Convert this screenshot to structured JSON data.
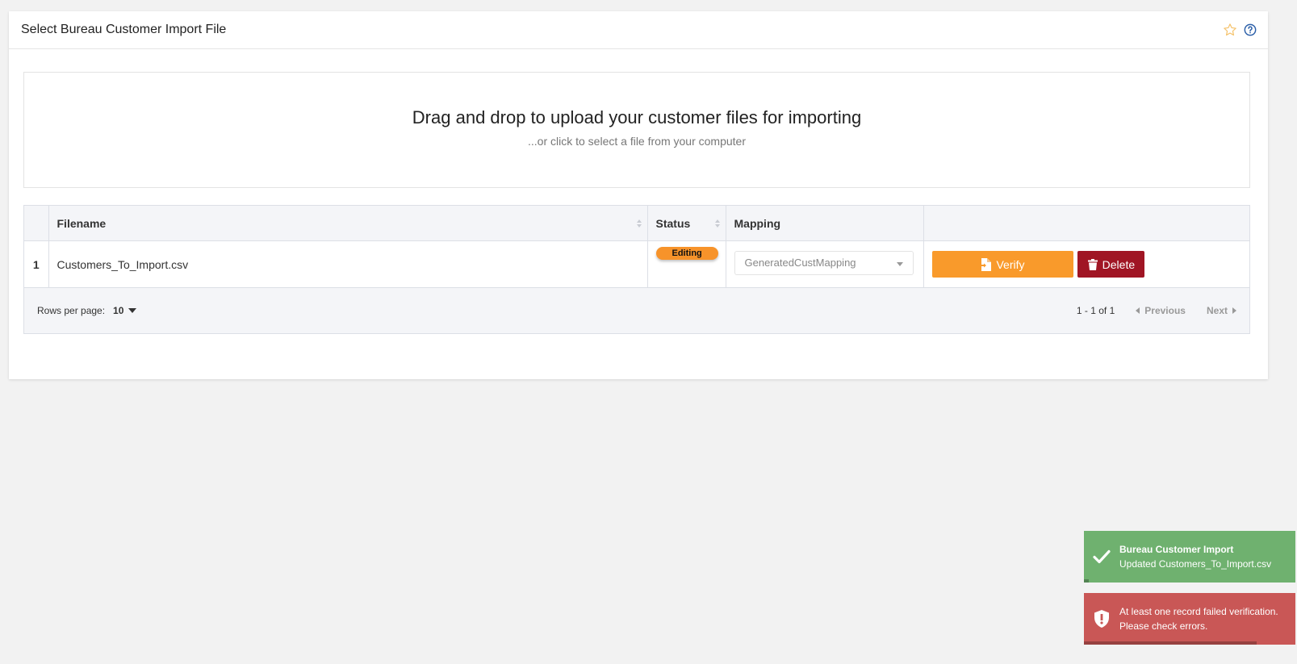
{
  "panel": {
    "title": "Select Bureau Customer Import File",
    "favorite_icon": "star-outline-icon",
    "help_icon": "question-circle-icon"
  },
  "dropzone": {
    "title": "Drag and drop to upload your customer files for importing",
    "subtitle": "...or click to select a file from your computer"
  },
  "table": {
    "columns": [
      "",
      "Filename",
      "Status",
      "Mapping",
      ""
    ],
    "rows": [
      {
        "index": "1",
        "filename": "Customers_To_Import.csv",
        "status": "Editing",
        "mapping": "GeneratedCustMapping",
        "verify_label": "Verify",
        "delete_label": "Delete"
      }
    ]
  },
  "footer": {
    "rows_per_page_label": "Rows per page:",
    "rows_per_page_value": "10",
    "range": "1 - 1 of 1",
    "previous_label": "Previous",
    "next_label": "Next"
  },
  "toasts": {
    "success": {
      "title": "Bureau Customer Import",
      "message": "Updated Customers_To_Import.csv",
      "icon": "check-icon"
    },
    "error": {
      "line1": "At least one record failed verification.",
      "line2": "Please check errors.",
      "icon": "shield-exclamation-icon"
    }
  },
  "colors": {
    "accent_orange": "#f99a2b",
    "danger_red": "#a01524",
    "success_green": "#6fb16f",
    "error_red": "#c95756"
  }
}
